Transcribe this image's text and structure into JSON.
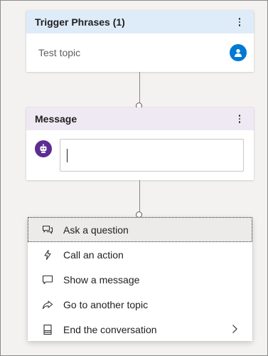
{
  "trigger_card": {
    "title": "Trigger Phrases (1)",
    "phrase": "Test topic",
    "header_color": "#deecf9",
    "badge_icon": "person-icon",
    "badge_color": "#0078d4"
  },
  "message_card": {
    "title": "Message",
    "header_color": "#efe9f4",
    "bot_icon": "bot-icon",
    "bot_color": "#5c2d91",
    "input_value": ""
  },
  "add_node_menu": {
    "items": [
      {
        "label": "Ask a question",
        "icon": "question-chat-icon",
        "highlighted": true
      },
      {
        "label": "Call an action",
        "icon": "lightning-icon"
      },
      {
        "label": "Show a message",
        "icon": "chat-bubble-icon"
      },
      {
        "label": "Go to another topic",
        "icon": "share-arrow-icon"
      },
      {
        "label": "End the conversation",
        "icon": "end-conversation-icon",
        "has_submenu": true
      }
    ]
  }
}
